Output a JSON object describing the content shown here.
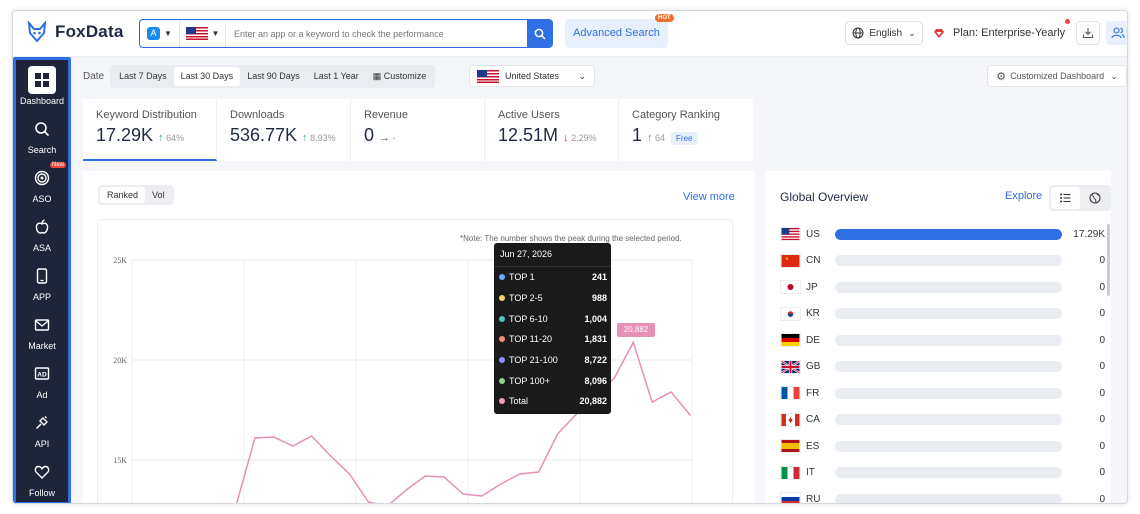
{
  "app": {
    "name": "FoxData"
  },
  "search": {
    "placeholder": "Enter an app or a keyword to check the performance",
    "store_icon": "app-store-icon",
    "country_flag": "us-flag"
  },
  "header": {
    "advanced_search": "Advanced Search",
    "hot_badge": "HOT",
    "language": "English",
    "plan": "Plan: Enterprise-Yearly"
  },
  "sidebar": {
    "items": [
      {
        "label": "Dashboard",
        "icon": "dashboard-icon",
        "active": true
      },
      {
        "label": "Search",
        "icon": "search-icon"
      },
      {
        "label": "ASO",
        "icon": "aso-icon",
        "badge": "New"
      },
      {
        "label": "ASA",
        "icon": "apple-icon"
      },
      {
        "label": "APP",
        "icon": "phone-icon"
      },
      {
        "label": "Market",
        "icon": "mail-icon"
      },
      {
        "label": "Ad",
        "icon": "ad-icon"
      },
      {
        "label": "API",
        "icon": "plug-icon"
      },
      {
        "label": "Follow",
        "icon": "heart-icon"
      }
    ]
  },
  "filters": {
    "date_label": "Date",
    "ranges": [
      "Last 7 Days",
      "Last 30 Days",
      "Last 90 Days",
      "Last 1 Year",
      "Customize"
    ],
    "active_range": "Last 30 Days",
    "country": "United States",
    "dashboard": "Customized Dashboard"
  },
  "metrics": [
    {
      "title": "Keyword Distribution",
      "value": "17.29K",
      "trend": "64%",
      "dir": "up"
    },
    {
      "title": "Downloads",
      "value": "536.77K",
      "trend": "8.93%",
      "dir": "up"
    },
    {
      "title": "Revenue",
      "value": "0",
      "trend": "-",
      "dir": "flat"
    },
    {
      "title": "Active Users",
      "value": "12.51M",
      "trend": "2.29%",
      "dir": "down"
    },
    {
      "title": "Category Ranking",
      "value": "1",
      "trend": "64",
      "dir": "up",
      "badge": "Free"
    }
  ],
  "chart_panel": {
    "toggle": [
      "Ranked",
      "Vol"
    ],
    "active_toggle": "Ranked",
    "view_more": "View more",
    "note": "*Note: The number shows the peak during the selected period.",
    "tooltip": {
      "date": "Jun 27, 2026",
      "rows": [
        {
          "name": "TOP 1",
          "value": "241",
          "color": "#6aa9ff"
        },
        {
          "name": "TOP 2-5",
          "value": "988",
          "color": "#f2d36b"
        },
        {
          "name": "TOP 6-10",
          "value": "1,004",
          "color": "#4fc3c3"
        },
        {
          "name": "TOP 11-20",
          "value": "1,831",
          "color": "#f08a7a"
        },
        {
          "name": "TOP 21-100",
          "value": "8,722",
          "color": "#8a8ff5"
        },
        {
          "name": "TOP 100+",
          "value": "8,096",
          "color": "#8fd18f"
        },
        {
          "name": "Total",
          "value": "20,882",
          "color": "#f29cc2"
        }
      ]
    },
    "peak_label": "20,882"
  },
  "chart_data": {
    "type": "line",
    "y_ticks": [
      "25K",
      "20K",
      "15K"
    ],
    "ylim": [
      12500,
      25000
    ],
    "series": [
      {
        "values": [
          12700,
          16100,
          16150,
          15700,
          16200,
          15200,
          14300,
          12900,
          12700,
          13500,
          14200,
          14150,
          13300,
          13200,
          13800,
          14300,
          14400,
          16300,
          17300,
          18100,
          19100,
          20882,
          17900,
          18400,
          17250
        ],
        "color": "#e88fb8"
      }
    ]
  },
  "overview": {
    "title": "Global Overview",
    "explore": "Explore",
    "rows": [
      {
        "code": "US",
        "value": "17.29K",
        "fill": 1.0,
        "flag": "us"
      },
      {
        "code": "CN",
        "value": "0",
        "fill": 0,
        "flag": "cn"
      },
      {
        "code": "JP",
        "value": "0",
        "fill": 0,
        "flag": "jp"
      },
      {
        "code": "KR",
        "value": "0",
        "fill": 0,
        "flag": "kr"
      },
      {
        "code": "DE",
        "value": "0",
        "fill": 0,
        "flag": "de"
      },
      {
        "code": "GB",
        "value": "0",
        "fill": 0,
        "flag": "gb"
      },
      {
        "code": "FR",
        "value": "0",
        "fill": 0,
        "flag": "fr"
      },
      {
        "code": "CA",
        "value": "0",
        "fill": 0,
        "flag": "ca"
      },
      {
        "code": "ES",
        "value": "0",
        "fill": 0,
        "flag": "es"
      },
      {
        "code": "IT",
        "value": "0",
        "fill": 0,
        "flag": "it"
      },
      {
        "code": "RU",
        "value": "0",
        "fill": 0,
        "flag": "ru"
      }
    ]
  }
}
